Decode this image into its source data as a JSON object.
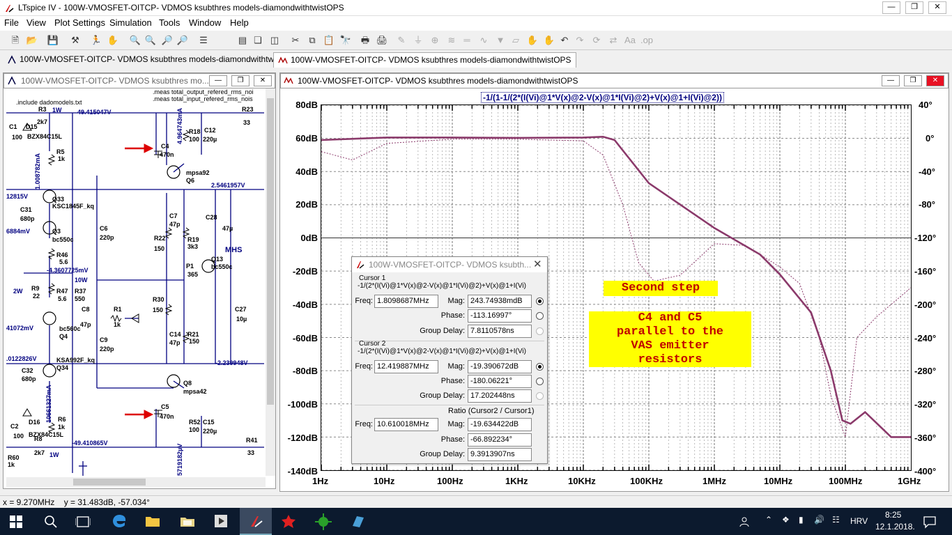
{
  "app": {
    "title": "LTspice IV - 100W-VMOSFET-OITCP- VDMOS ksubthres models-diamondwithtwistOPS"
  },
  "menu": [
    "File",
    "View",
    "Plot Settings",
    "Simulation",
    "Tools",
    "Window",
    "Help"
  ],
  "tabs": [
    {
      "label": "100W-VMOSFET-OITCP- VDMOS ksubthres models-diamondwithtwistOPS",
      "icon": "schematic-icon"
    },
    {
      "label": "100W-VMOSFET-OITCP- VDMOS ksubthres models-diamondwithtwistOPS",
      "icon": "waveform-icon"
    }
  ],
  "schematic": {
    "title": "100W-VMOSFET-OITCP- VDMOS ksubthres mo...",
    "labels": {
      "include": ".include dadomodels.txt",
      "meas1": ".meas total_output_refered_rms_noi",
      "meas2": ".meas total_input_refered_rms_nois",
      "r3": "R3",
      "r3v": "2k7",
      "w1": "1W",
      "n1": "49.415047V",
      "r23": "R23",
      "r23v": "33",
      "c1": "C1",
      "d15": "D15",
      "c1v": "100",
      "d15v": "BZX84C15L",
      "r5": "R5",
      "r5v": "1k",
      "i1": "1.008782mA",
      "c4": "C4",
      "c4v": "470n",
      "i2": "4.964743mA",
      "r18": "R18",
      "r18v": "100",
      "c12": "C12",
      "c12v": "220µ",
      "q6": "mpsa92",
      "q6n": "Q6",
      "n2": "12815V",
      "q33": "Q33",
      "q33v": "KSC1845F_kq",
      "n3": "2.5461957V",
      "c31": "C31",
      "c31v": "680p",
      "c7": "C7",
      "c7v": "47p",
      "c28": "C28",
      "c28v": "47µ",
      "c6": "C6",
      "c6v": "220p",
      "n4": "6884mV",
      "q3": "Q3",
      "q3v": "bc550c",
      "r22": "R22",
      "r22v": "150",
      "r19": "R19",
      "r19v": "3k3",
      "mhs": "MHS",
      "r46": "R46",
      "r46v": "5.6",
      "p1": "P1",
      "p1v": "365",
      "q13": "Q13",
      "q13v": "bc550c",
      "n5": "-4.3607725mV",
      "w2": "2W",
      "r9": "R9",
      "r9v": "22",
      "r47": "R47",
      "r47v": "5.6",
      "r37": "R37",
      "r37v": "550",
      "w10": "10W",
      "r30": "R30",
      "r30v": "150",
      "c8": "C8",
      "c8v": "47p",
      "r1": "R1",
      "r1v": "1k",
      "c27": "C27",
      "c27v": "10µ",
      "n6": "41072mV",
      "q4": "bc560c",
      "q4n": "Q4",
      "c14": "C14",
      "c14v": "47p",
      "r21": "R21",
      "r21v": "150",
      "c9": "C9",
      "c9v": "220p",
      "n7": ".0122826V",
      "q34": "KSA992F_kq",
      "q34n": "Q34",
      "n8": "-2.239948V",
      "c32": "C32",
      "c32v": "680p",
      "q8": "Q8",
      "q8v": "mpsa42",
      "i3": "10661327mA",
      "c5": "C5",
      "c5v": "470n",
      "r6": "R6",
      "r6v": "1k",
      "r52": "R52",
      "r52v": "100",
      "c15": "C15",
      "c15v": "220µ",
      "c2": "C2",
      "d16": "D16",
      "c2v": "100",
      "d16v": "BZX84C15L",
      "n9": "-49.410865V",
      "r8": "R8",
      "r8v": "2k7",
      "w1b": "1W",
      "r41": "R41",
      "r41v": "33",
      "r60": "R60",
      "r60v": "1k",
      "i4": "5719182µV"
    }
  },
  "plot": {
    "title": "100W-VMOSFET-OITCP- VDMOS ksubthres models-diamondwithtwistOPS",
    "trace_label": "-1/(1-1/(2*(I(Vi)@1*V(x)@2-V(x)@1*I(Vi)@2)+V(x)@1+I(Vi)@2))",
    "y_left": [
      "80dB",
      "60dB",
      "40dB",
      "20dB",
      "0dB",
      "-20dB",
      "-40dB",
      "-60dB",
      "-80dB",
      "-100dB",
      "-120dB",
      "-140dB"
    ],
    "y_right": [
      "40°",
      "0°",
      "-40°",
      "-80°",
      "-120°",
      "-160°",
      "-200°",
      "-240°",
      "-280°",
      "-320°",
      "-360°",
      "-400°"
    ],
    "x_labels": [
      "1Hz",
      "10Hz",
      "100Hz",
      "1KHz",
      "10KHz",
      "100KHz",
      "1MHz",
      "10MHz",
      "100MHz",
      "1GHz"
    ],
    "trace_color": "#8b3a6b",
    "annotation1": "Second step",
    "annotation2": [
      "C4 and C5",
      "parallel to the",
      "VAS emitter",
      "resistors"
    ]
  },
  "chart_data": {
    "type": "line",
    "xscale": "log",
    "xlim": [
      1,
      1000000000
    ],
    "ylim": [
      -140,
      80
    ],
    "y2lim": [
      -400,
      40
    ],
    "grid": true,
    "series": [
      {
        "name": "-1/(1-1/(2*(I(Vi)@1*V(x)@2-V(x)@1*I(Vi)@2)+V(x)@1+I(Vi)@2))",
        "style": "solid",
        "axis": "left",
        "x": [
          1,
          10,
          100,
          1000,
          10000,
          20000,
          30000,
          100000,
          1000000,
          5000000,
          10000000,
          30000000,
          60000000,
          90000000,
          120000000,
          200000000,
          500000000,
          1000000000
        ],
        "y": [
          59,
          60.5,
          60.5,
          60.3,
          60.5,
          61,
          59,
          33,
          6,
          -10,
          -22,
          -45,
          -80,
          -110,
          -112,
          -105,
          -120,
          -120
        ]
      },
      {
        "name": "phase",
        "style": "dashed",
        "axis": "right",
        "x": [
          1,
          3,
          10,
          100,
          1000,
          10000,
          20000,
          40000,
          70000,
          120000,
          300000,
          1000000,
          3000000,
          10000000,
          20000000,
          40000000,
          60000000,
          100000000,
          150000000,
          300000000,
          1000000000
        ],
        "y": [
          -16,
          -26,
          -6,
          -1,
          -1,
          -3,
          -20,
          -80,
          -150,
          -172,
          -165,
          -127,
          -129,
          -155,
          -175,
          -240,
          -310,
          -360,
          -240,
          -215,
          -180
        ]
      }
    ]
  },
  "cursor_dialog": {
    "title": "100W-VMOSFET-OITCP- VDMOS ksubth...",
    "cursor1": {
      "header": "Cursor 1",
      "expr": "-1/(2*(I(Vi)@1*V(x)@2-V(x)@1*I(Vi)@2)+V(x)@1+I(Vi)",
      "freq_label": "Freq:",
      "freq": "1.8098687MHz",
      "mag_label": "Mag:",
      "mag": "243.74938mdB",
      "phase_label": "Phase:",
      "phase": "-113.16997°",
      "gd_label": "Group Delay:",
      "gd": "7.8110578ns"
    },
    "cursor2": {
      "header": "Cursor 2",
      "expr": "-1/(2*(I(Vi)@1*V(x)@2-V(x)@1*I(Vi)@2)+V(x)@1+I(Vi)",
      "freq_label": "Freq:",
      "freq": "12.419887MHz",
      "mag_label": "Mag:",
      "mag": "-19.390672dB",
      "phase_label": "Phase:",
      "phase": "-180.06221°",
      "gd_label": "Group Delay:",
      "gd": "17.202448ns"
    },
    "ratio": {
      "header": "Ratio (Cursor2 / Cursor1)",
      "freq_label": "Freq:",
      "freq": "10.610018MHz",
      "mag_label": "Mag:",
      "mag": "-19.634422dB",
      "phase_label": "Phase:",
      "phase": "-66.892234°",
      "gd_label": "Group Delay:",
      "gd": "9.3913907ns"
    }
  },
  "status": "x = 9.270MHz    y = 31.483dB, -57.034°",
  "taskbar": {
    "lang": "HRV",
    "time": "8:25",
    "date": "12.1.2018."
  }
}
